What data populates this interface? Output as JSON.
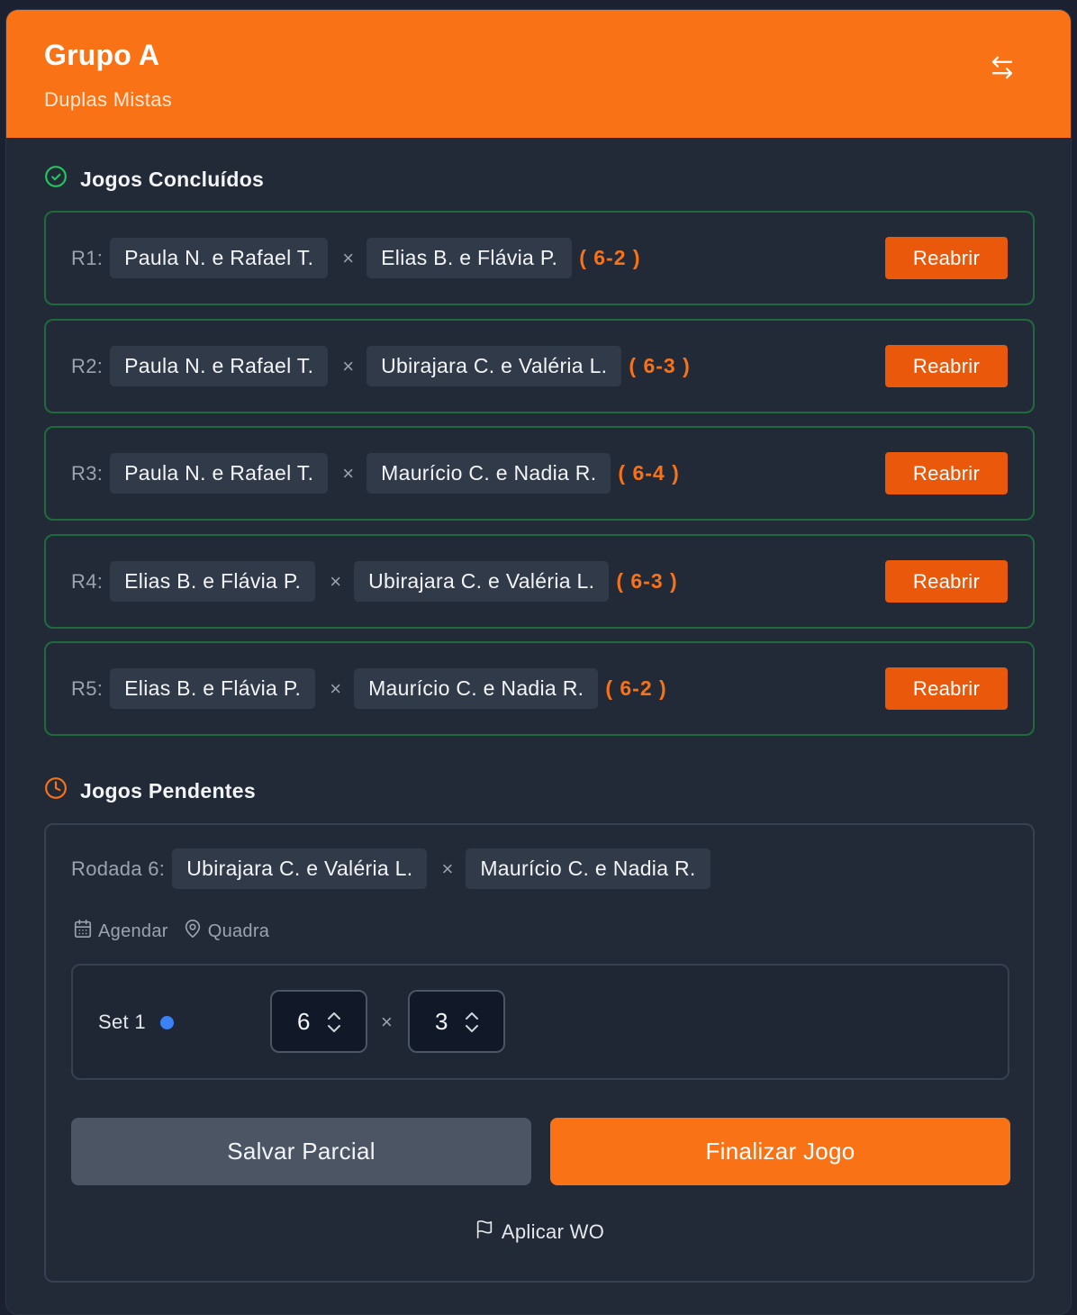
{
  "header": {
    "title": "Grupo A",
    "subtitle": "Duplas Mistas",
    "swap_icon": "swap-arrows-icon"
  },
  "completed": {
    "title": "Jogos Concluídos",
    "icon": "check-circle-icon",
    "icon_color": "#22c55e",
    "matches": [
      {
        "round": "R1:",
        "team_a": "Paula N. e Rafael T.",
        "vs": "×",
        "team_b": "Elias B. e Flávia P.",
        "score": "( 6-2 )",
        "action": "Reabrir"
      },
      {
        "round": "R2:",
        "team_a": "Paula N. e Rafael T.",
        "vs": "×",
        "team_b": "Ubirajara C. e Valéria L.",
        "score": "( 6-3 )",
        "action": "Reabrir"
      },
      {
        "round": "R3:",
        "team_a": "Paula N. e Rafael T.",
        "vs": "×",
        "team_b": "Maurício C. e Nadia R.",
        "score": "( 6-4 )",
        "action": "Reabrir"
      },
      {
        "round": "R4:",
        "team_a": "Elias B. e Flávia P.",
        "vs": "×",
        "team_b": "Ubirajara C. e Valéria L.",
        "score": "( 6-3 )",
        "action": "Reabrir"
      },
      {
        "round": "R5:",
        "team_a": "Elias B. e Flávia P.",
        "vs": "×",
        "team_b": "Maurício C. e Nadia R.",
        "score": "( 6-2 )",
        "action": "Reabrir"
      }
    ]
  },
  "pending": {
    "title": "Jogos Pendentes",
    "icon": "clock-icon",
    "icon_color": "#f97316",
    "match": {
      "round": "Rodada 6:",
      "team_a": "Ubirajara C. e Valéria L.",
      "vs": "×",
      "team_b": "Maurício C. e Nadia R.",
      "schedule_label": "Agendar",
      "court_label": "Quadra",
      "set": {
        "label": "Set 1",
        "score_a": "6",
        "vs": "×",
        "score_b": "3"
      },
      "save_label": "Salvar Parcial",
      "finish_label": "Finalizar Jogo",
      "wo_label": "Aplicar WO"
    }
  },
  "colors": {
    "accent": "#f97316",
    "success_border": "#1f6b3d",
    "background": "#222a37"
  }
}
